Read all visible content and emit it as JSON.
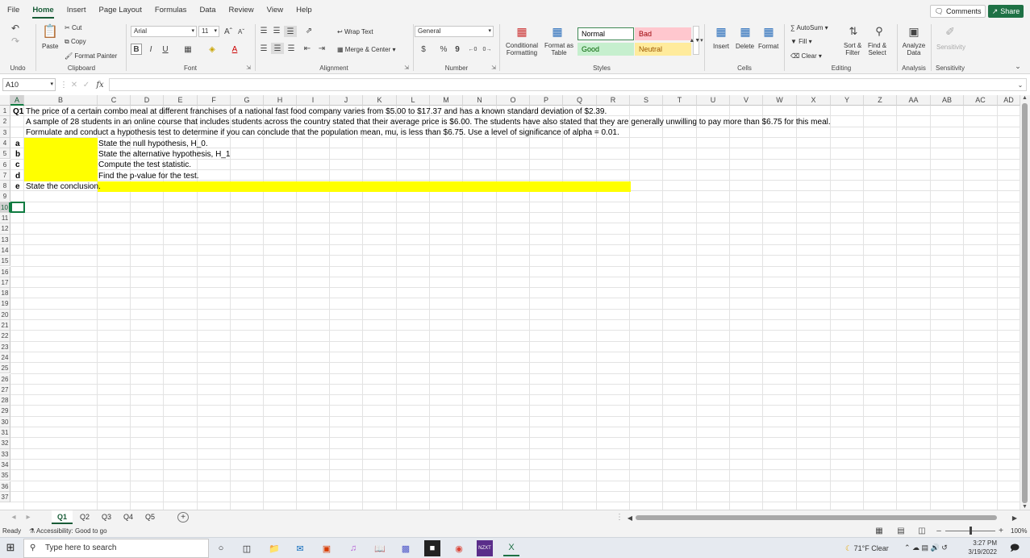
{
  "menu": {
    "tabs": [
      "File",
      "Home",
      "Insert",
      "Page Layout",
      "Formulas",
      "Data",
      "Review",
      "View",
      "Help"
    ],
    "comments": "Comments",
    "share": "Share"
  },
  "ribbon": {
    "undo_label": "Undo",
    "clipboard": {
      "paste": "Paste",
      "cut": "Cut",
      "copy": "Copy",
      "format_painter": "Format Painter",
      "label": "Clipboard"
    },
    "font": {
      "name": "Arial",
      "size": "11",
      "label": "Font",
      "bold": "B",
      "italic": "I",
      "underline": "U"
    },
    "alignment": {
      "wrap": "Wrap Text",
      "merge": "Merge & Center",
      "label": "Alignment"
    },
    "number": {
      "format": "General",
      "label": "Number",
      "currency": "$",
      "percent": "%",
      "comma": "9"
    },
    "styles": {
      "cond1": "Conditional",
      "cond2": "Formatting",
      "fat1": "Format as",
      "fat2": "Table",
      "normal": "Normal",
      "bad": "Bad",
      "good": "Good",
      "neutral": "Neutral",
      "label": "Styles"
    },
    "cells": {
      "insert": "Insert",
      "delete": "Delete",
      "format": "Format",
      "label": "Cells"
    },
    "editing": {
      "autosum": "AutoSum",
      "fill": "Fill",
      "clear": "Clear",
      "sort1": "Sort &",
      "sort2": "Filter",
      "find1": "Find &",
      "find2": "Select",
      "label": "Editing"
    },
    "analysis": {
      "a1": "Analyze",
      "a2": "Data",
      "label": "Analysis"
    },
    "sensitivity": {
      "btn": "Sensitivity",
      "label": "Sensitivity"
    }
  },
  "formula_bar": {
    "name_box": "A10",
    "fx": "fx",
    "content": ""
  },
  "columns": [
    "A",
    "B",
    "C",
    "D",
    "E",
    "F",
    "G",
    "H",
    "I",
    "J",
    "K",
    "L",
    "M",
    "N",
    "O",
    "P",
    "Q",
    "R",
    "S",
    "T",
    "U",
    "V",
    "W",
    "X",
    "Y",
    "Z",
    "AA",
    "AB",
    "AC",
    "AD"
  ],
  "rows": [
    "1",
    "2",
    "3",
    "4",
    "5",
    "6",
    "7",
    "8",
    "9",
    "10",
    "11",
    "12",
    "13",
    "14",
    "15",
    "16",
    "17",
    "18",
    "19",
    "20",
    "21",
    "22",
    "23",
    "24",
    "25",
    "26",
    "27",
    "28",
    "29",
    "30",
    "31",
    "32",
    "33",
    "34",
    "35",
    "36",
    "37"
  ],
  "cells": {
    "a1": "Q1",
    "b1": "The price of a certain combo meal at different franchises of a national fast food company varies from $5.00 to $17.37 and has a known standard deviation of $2.39.",
    "b2": "A sample of  28 students in an online course that includes students across the country stated that their average price is $6.00. The students have also stated that they are generally unwilling to pay more than $6.75 for this meal.",
    "b3": "Formulate and conduct a hypothesis test to determine if you can conclude that the population mean, mu, is less than $6.75. Use a level of significance of alpha = 0.01.",
    "a4": "a",
    "c4": "State the null hypothesis, H_0.",
    "a5": "b",
    "c5": "State the alternative hypothesis, H_1",
    "a6": "c",
    "c6": "Compute the test statistic.",
    "a7": "d",
    "c7": "Find the p-value for the test.",
    "a8": "e",
    "b8": "State the conclusion."
  },
  "sheets": [
    "Q1",
    "Q2",
    "Q3",
    "Q4",
    "Q5"
  ],
  "status": {
    "ready": "Ready",
    "accessibility": "Accessibility: Good to go",
    "zoom": "100%"
  },
  "taskbar": {
    "search": "Type here to search",
    "weather": "71°F  Clear",
    "time": "3:27 PM",
    "date": "3/19/2022"
  },
  "colors": {
    "accent": "#185c37",
    "highlight": "#ffff00",
    "share": "#1e7145"
  }
}
